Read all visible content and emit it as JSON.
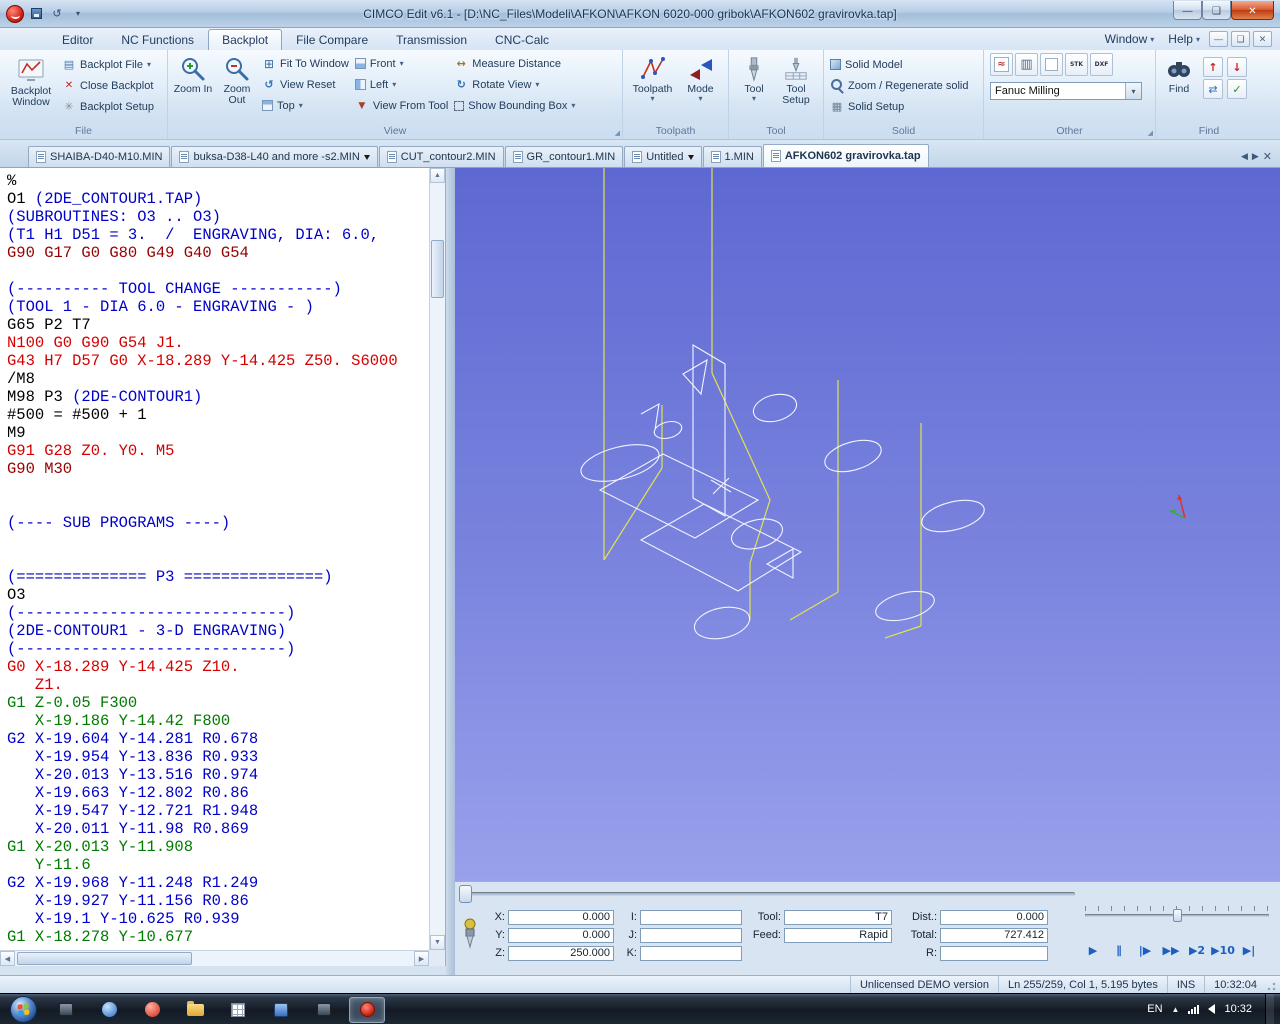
{
  "window": {
    "title": "CIMCO Edit v6.1 - [D:\\NC_Files\\Modeli\\AFKON\\AFKON 6020-000 gribok\\AFKON602 gravirovka.tap]"
  },
  "menu_tabs": [
    {
      "label": "Editor"
    },
    {
      "label": "NC Functions"
    },
    {
      "label": "Backplot",
      "active": true
    },
    {
      "label": "File Compare"
    },
    {
      "label": "Transmission"
    },
    {
      "label": "CNC-Calc"
    }
  ],
  "menu_right": {
    "window_label": "Window",
    "help_label": "Help"
  },
  "ribbon": {
    "file": {
      "label": "File",
      "big_label": "Backplot Window",
      "items": [
        {
          "label": "Backplot File",
          "icon": "backplot-file",
          "dd": true
        },
        {
          "label": "Close Backplot",
          "icon": "close-backplot",
          "dd": false
        },
        {
          "label": "Backplot Setup",
          "icon": "backplot-setup",
          "dd": false
        }
      ]
    },
    "view": {
      "label": "View",
      "zoom_in": "Zoom In",
      "zoom_out": "Zoom Out",
      "columns": [
        [
          {
            "label": "Fit To Window",
            "icon": "fit-to-window",
            "dd": false
          },
          {
            "label": "View Reset",
            "icon": "view-reset",
            "dd": false
          },
          {
            "label": "Top",
            "icon": "top",
            "dd": true
          }
        ],
        [
          {
            "label": "Front",
            "icon": "front",
            "dd": true
          },
          {
            "label": "Left",
            "icon": "left",
            "dd": true
          },
          {
            "label": "View From Tool",
            "icon": "view-from-tool",
            "dd": false
          }
        ],
        [
          {
            "label": "Measure Distance",
            "icon": "measure-distance",
            "dd": false
          },
          {
            "label": "Rotate View",
            "icon": "rotate-view",
            "dd": true
          },
          {
            "label": "Show Bounding Box",
            "icon": "show-bounding-box",
            "dd": true
          }
        ]
      ]
    },
    "toolpath": {
      "label": "Toolpath",
      "toolpath_label": "Toolpath",
      "mode_label": "Mode"
    },
    "tool": {
      "label": "Tool",
      "tool_label": "Tool",
      "tool_setup_label": "Tool Setup"
    },
    "solid": {
      "label": "Solid",
      "items": [
        {
          "label": "Solid Model",
          "icon": "solid-model",
          "dd": false
        },
        {
          "label": "Zoom / Regenerate solid",
          "icon": "zoom-regenerate",
          "dd": false
        },
        {
          "label": "Solid Setup",
          "icon": "solid-setup",
          "dd": false
        }
      ]
    },
    "other": {
      "label": "Other",
      "machine": "Fanuc Milling",
      "icons": [
        {
          "name": "graph"
        },
        {
          "name": "layout"
        },
        {
          "name": "new-window"
        },
        {
          "name": "stock"
        },
        {
          "name": "dxf"
        }
      ]
    },
    "find": {
      "label": "Find",
      "find_label": "Find",
      "items": [
        {
          "name": "find-previous"
        },
        {
          "name": "find-next"
        },
        {
          "name": "replace"
        },
        {
          "name": "mark-all"
        }
      ]
    }
  },
  "file_tabs": [
    {
      "label": "SHAIBA-D40-M10.MIN"
    },
    {
      "label": "buksa-D38-L40 and more -s2.MIN",
      "modified": true
    },
    {
      "label": "CUT_contour2.MIN"
    },
    {
      "label": "GR_contour1.MIN"
    },
    {
      "label": "Untitled",
      "modified": true
    },
    {
      "label": "1.MIN"
    },
    {
      "label": "AFKON602 gravirovka.tap",
      "active": true
    }
  ],
  "editor": {
    "lines": [
      [
        [
          "%",
          "k"
        ]
      ],
      [
        [
          "O1 ",
          "k"
        ],
        [
          "(2DE_CONTOUR1.TAP)",
          "b"
        ]
      ],
      [
        [
          "(SUBROUTINES: O3 .. O3)",
          "b"
        ]
      ],
      [
        [
          "(T1 H1 D51 = 3.  /  ENGRAVING, DIA: 6.0,",
          "b"
        ]
      ],
      [
        [
          "G90 G17 G0 G80 G49 G40 G54",
          "m"
        ]
      ],
      [],
      [
        [
          "(---------- TOOL CHANGE -----------)",
          "b"
        ]
      ],
      [
        [
          "(TOOL 1 - DIA 6.0 - ENGRAVING - )",
          "b"
        ]
      ],
      [
        [
          "G65 P2 T7",
          "k"
        ]
      ],
      [
        [
          "N100 G0 G90 G54 J1.",
          "r"
        ]
      ],
      [
        [
          "G43 H7 D57 G0 X-18.289 Y-14.425 Z50. S6000",
          "r"
        ]
      ],
      [
        [
          "/M8",
          "k"
        ]
      ],
      [
        [
          "M98 P3 ",
          "k"
        ],
        [
          "(2DE-CONTOUR1)",
          "b"
        ]
      ],
      [
        [
          "#500 = #500 + 1",
          "k"
        ]
      ],
      [
        [
          "M9",
          "k"
        ]
      ],
      [
        [
          "G91 G28 Z0. Y0. M5",
          "r"
        ]
      ],
      [
        [
          "G90 M30",
          "m"
        ]
      ],
      [],
      [],
      [
        [
          "(---- SUB PROGRAMS ----)",
          "b"
        ]
      ],
      [],
      [],
      [
        [
          "(============== P3 ===============)",
          "b"
        ]
      ],
      [
        [
          "O3",
          "k"
        ]
      ],
      [
        [
          "(-----------------------------)",
          "b"
        ]
      ],
      [
        [
          "(2DE-CONTOUR1 - 3-D ENGRAVING)",
          "b"
        ]
      ],
      [
        [
          "(-----------------------------)",
          "b"
        ]
      ],
      [
        [
          "G0 X-18.289 Y-14.425 Z10.",
          "r"
        ]
      ],
      [
        [
          "   Z1.",
          "r"
        ]
      ],
      [
        [
          "G1 Z-0.05 F300",
          "g"
        ]
      ],
      [
        [
          "   X-19.186 Y-14.42 F800",
          "g"
        ]
      ],
      [
        [
          "G2 X-19.604 Y-14.281 R0.678",
          "b"
        ]
      ],
      [
        [
          "   X-19.954 Y-13.836 R0.933",
          "b"
        ]
      ],
      [
        [
          "   X-20.013 Y-13.516 R0.974",
          "b"
        ]
      ],
      [
        [
          "   X-19.663 Y-12.802 R0.86",
          "b"
        ]
      ],
      [
        [
          "   X-19.547 Y-12.721 R1.948",
          "b"
        ]
      ],
      [
        [
          "   X-20.011 Y-11.98 R0.869",
          "b"
        ]
      ],
      [
        [
          "G1 X-20.013 Y-11.908",
          "g"
        ]
      ],
      [
        [
          "   Y-11.6",
          "g"
        ]
      ],
      [
        [
          "G2 X-19.968 Y-11.248 R1.249",
          "b"
        ]
      ],
      [
        [
          "   X-19.927 Y-11.156 R0.86",
          "b"
        ]
      ],
      [
        [
          "   X-19.1 Y-10.625 R0.939",
          "b"
        ]
      ],
      [
        [
          "G1 X-18.278 Y-10.677",
          "g"
        ]
      ]
    ]
  },
  "backplot": {
    "rows": [
      [
        {
          "l": "X:",
          "v": "0.000",
          "n": "x"
        },
        {
          "l": "I:",
          "v": "",
          "n": "i"
        },
        {
          "l": "Tool:",
          "v": "T7",
          "n": "tool"
        },
        {
          "l": "Dist.:",
          "v": "0.000",
          "n": "dist"
        }
      ],
      [
        {
          "l": "Y:",
          "v": "0.000",
          "n": "y"
        },
        {
          "l": "J:",
          "v": "",
          "n": "j"
        },
        {
          "l": "Feed:",
          "v": "Rapid",
          "n": "feed"
        },
        {
          "l": "Total:",
          "v": "727.412",
          "n": "total"
        }
      ],
      [
        {
          "l": "Z:",
          "v": "250.000",
          "n": "z"
        },
        {
          "l": "K:",
          "v": "",
          "n": "k"
        },
        null,
        {
          "l": "R:",
          "v": "",
          "n": "r"
        }
      ]
    ],
    "playback": [
      {
        "name": "play",
        "glyph": "▶"
      },
      {
        "name": "pause",
        "glyph": "∥"
      },
      {
        "name": "step-back",
        "glyph": "|▶"
      },
      {
        "name": "step-forward",
        "glyph": "▶▶"
      },
      {
        "name": "skip-2",
        "glyph": "▶2"
      },
      {
        "name": "skip-10",
        "glyph": "▶10"
      },
      {
        "name": "skip-to-end",
        "glyph": "▶|"
      }
    ]
  },
  "status": {
    "demo": "Unlicensed DEMO version",
    "position": "Ln 255/259, Col 1, 5.195 bytes",
    "insert_mode": "INS",
    "time": "10:32:04"
  },
  "taskbar": {
    "apps": [
      {
        "name": "system-window",
        "style": "dark"
      },
      {
        "name": "media-player",
        "style": "media"
      },
      {
        "name": "browser",
        "style": "red"
      },
      {
        "name": "file-explorer",
        "style": "folder"
      },
      {
        "name": "calculator",
        "style": "grid"
      },
      {
        "name": "blue-app",
        "style": "blue"
      },
      {
        "name": "player",
        "style": "dark"
      },
      {
        "name": "cimco-edit",
        "style": "cimco",
        "active": true
      }
    ],
    "lang": "EN",
    "time": "10:32"
  }
}
